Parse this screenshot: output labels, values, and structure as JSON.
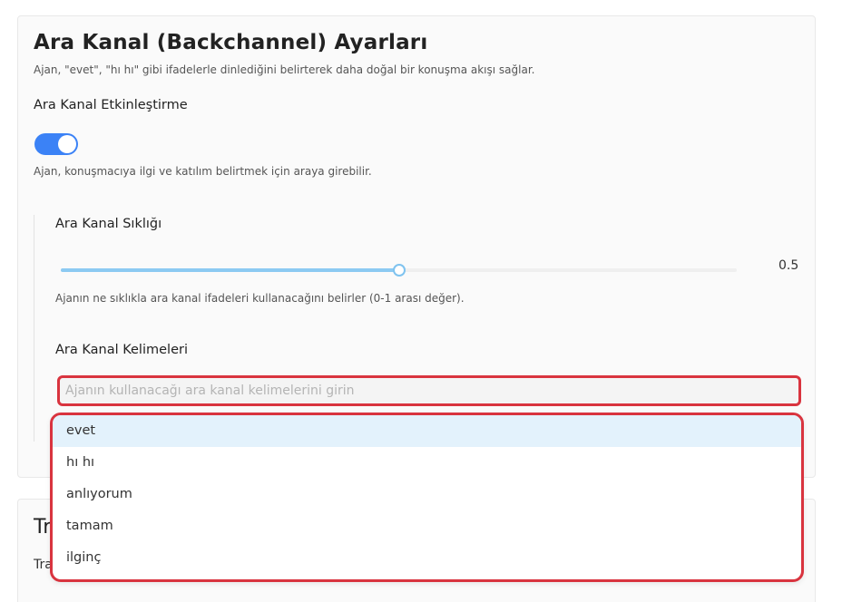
{
  "section": {
    "title": "Ara Kanal (Backchannel) Ayarları",
    "description": "Ajan, \"evet\", \"hı hı\" gibi ifadelerle dinlediğini belirterek daha doğal bir konuşma akışı sağlar."
  },
  "enable": {
    "label": "Ara Kanal Etkinleştirme",
    "checked": true,
    "help": "Ajan, konuşmacıya ilgi ve katılım belirtmek için araya girebilir."
  },
  "frequency": {
    "label": "Ara Kanal Sıklığı",
    "value": 0.5,
    "value_text": "0.5",
    "min": 0,
    "max": 1,
    "help": "Ajanın ne sıklıkla ara kanal ifadeleri kullanacağını belirler (0-1 arası değer)."
  },
  "words": {
    "label": "Ara Kanal Kelimeleri",
    "value": "",
    "placeholder": "Ajanın kullanacağı ara kanal kelimelerini girin",
    "options": [
      "evet",
      "hı hı",
      "anlıyorum",
      "tamam",
      "ilginç"
    ]
  },
  "next_section": {
    "title": "Tr",
    "label": "Tra"
  },
  "colors": {
    "accent": "#3b82f6",
    "slider_fill": "#8ccaf2",
    "highlight_border": "#d9343f",
    "option_hover": "#e3f2fc"
  }
}
